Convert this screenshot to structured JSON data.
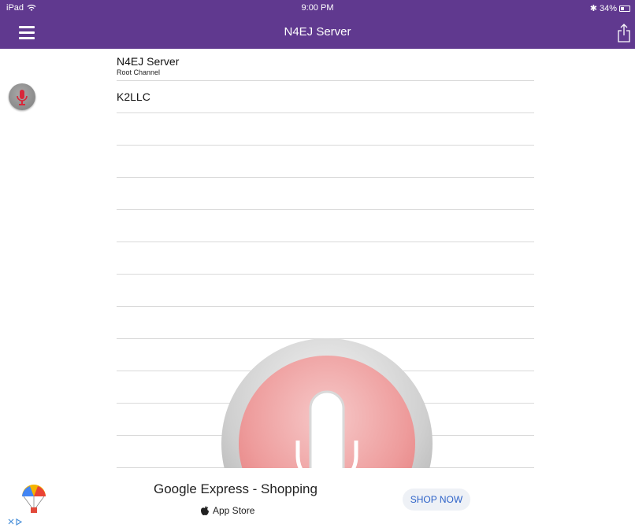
{
  "status_bar": {
    "device": "iPad",
    "time": "9:00 PM",
    "bluetooth": "✱",
    "battery": "34%"
  },
  "nav": {
    "title": "N4EJ Server"
  },
  "channel": {
    "name": "N4EJ Server",
    "subtitle": "Root Channel"
  },
  "users": [
    {
      "name": "K2LLC"
    }
  ],
  "ad": {
    "title": "Google Express - Shopping",
    "store": "App Store",
    "cta": "SHOP NOW"
  },
  "colors": {
    "nav_bg": "#60398f",
    "talk_red": "#e06e6e",
    "cta_text": "#2d62c8"
  }
}
